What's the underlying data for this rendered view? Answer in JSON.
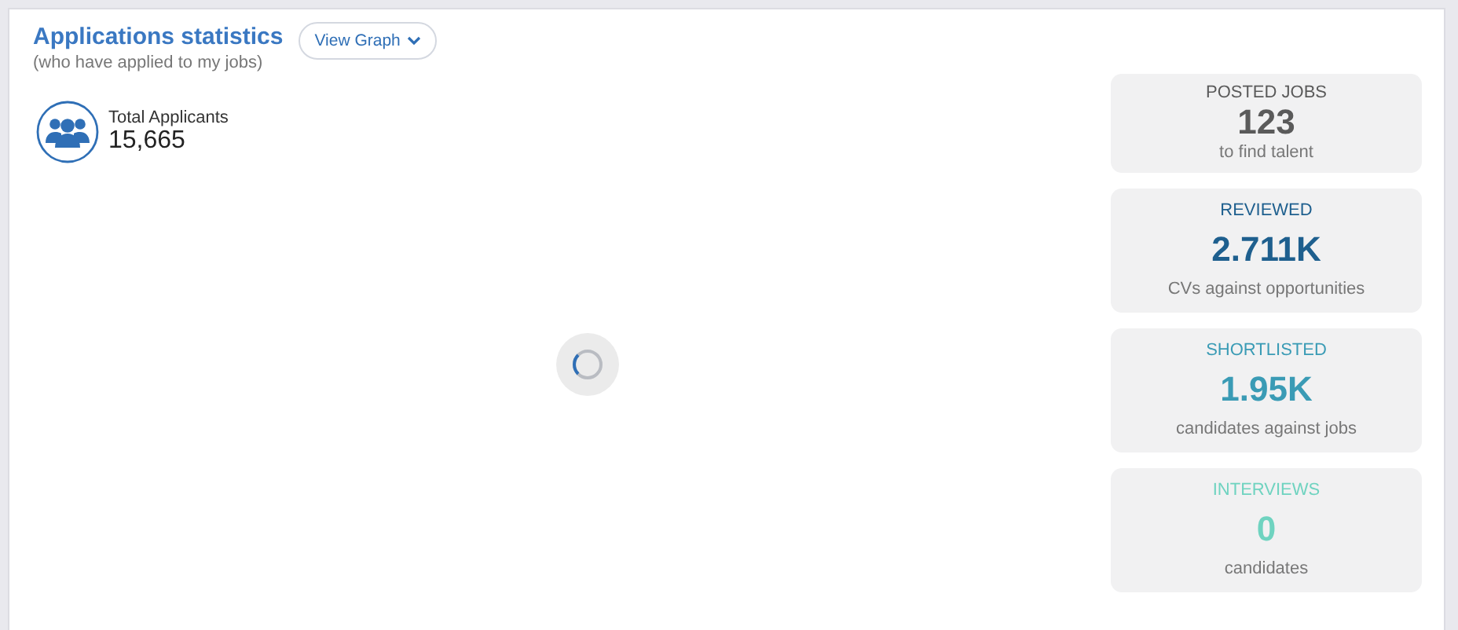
{
  "header": {
    "title": "Applications statistics",
    "subtitle": "(who have applied to my jobs)",
    "view_button": "View Graph"
  },
  "total": {
    "label": "Total Applicants",
    "value": "15,665"
  },
  "loading": true,
  "stats": [
    {
      "label": "POSTED JOBS",
      "value": "123",
      "caption": "to find talent",
      "color": "#5a5a5a"
    },
    {
      "label": "REVIEWED",
      "value": "2.711K",
      "caption": "CVs against opportunities",
      "color": "#1e5f8e"
    },
    {
      "label": "SHORTLISTED",
      "value": "1.95K",
      "caption": "candidates against jobs",
      "color": "#3a9bb5"
    },
    {
      "label": "INTERVIEWS",
      "value": "0",
      "caption": "candidates",
      "color": "#6fd3c0"
    }
  ]
}
